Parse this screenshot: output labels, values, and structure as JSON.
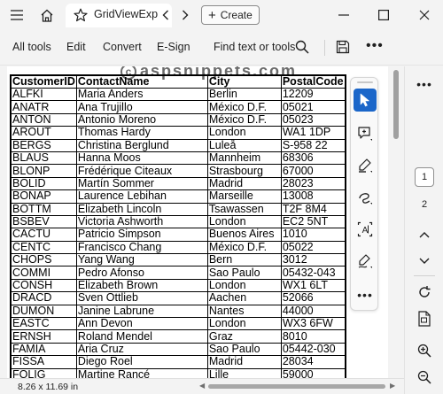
{
  "titlebar": {
    "tab_title": "GridViewExp",
    "create_label": "Create",
    "colors": {
      "bg": "#f3f3f3",
      "tab_bg": "#ffffff"
    }
  },
  "commandbar": {
    "all_tools": "All tools",
    "edit": "Edit",
    "convert": "Convert",
    "esign": "E-Sign",
    "find": "Find text or tools"
  },
  "watermark": {
    "symbol": "c",
    "text": "aspsnippets.com"
  },
  "table": {
    "headers": [
      "CustomerID",
      "ContactName",
      "City",
      "PostalCode"
    ],
    "rows": [
      [
        "ALFKI",
        "Maria Anders",
        "Berlin",
        "12209"
      ],
      [
        "ANATR",
        "Ana Trujillo",
        "México D.F.",
        "05021"
      ],
      [
        "ANTON",
        "Antonio Moreno",
        "México D.F.",
        "05023"
      ],
      [
        "AROUT",
        "Thomas Hardy",
        "London",
        "WA1 1DP"
      ],
      [
        "BERGS",
        "Christina Berglund",
        "Luleå",
        "S-958 22"
      ],
      [
        "BLAUS",
        "Hanna Moos",
        "Mannheim",
        "68306"
      ],
      [
        "BLONP",
        "Frédérique Citeaux",
        "Strasbourg",
        "67000"
      ],
      [
        "BOLID",
        "Martín Sommer",
        "Madrid",
        "28023"
      ],
      [
        "BONAP",
        "Laurence Lebihan",
        "Marseille",
        "13008"
      ],
      [
        "BOTTM",
        "Elizabeth Lincoln",
        "Tsawassen",
        "T2F 8M4"
      ],
      [
        "BSBEV",
        "Victoria Ashworth",
        "London",
        "EC2 5NT"
      ],
      [
        "CACTU",
        "Patricio Simpson",
        "Buenos Aires",
        "1010"
      ],
      [
        "CENTC",
        "Francisco Chang",
        "México D.F.",
        "05022"
      ],
      [
        "CHOPS",
        "Yang Wang",
        "Bern",
        "3012"
      ],
      [
        "COMMI",
        "Pedro Afonso",
        "Sao Paulo",
        "05432-043"
      ],
      [
        "CONSH",
        "Elizabeth Brown",
        "London",
        "WX1 6LT"
      ],
      [
        "DRACD",
        "Sven Ottlieb",
        "Aachen",
        "52066"
      ],
      [
        "DUMON",
        "Janine Labrune",
        "Nantes",
        "44000"
      ],
      [
        "EASTC",
        "Ann Devon",
        "London",
        "WX3 6FW"
      ],
      [
        "ERNSH",
        "Roland Mendel",
        "Graz",
        "8010"
      ],
      [
        "FAMIA",
        "Aria Cruz",
        "Sao Paulo",
        "05442-030"
      ],
      [
        "FISSA",
        "Diego Roel",
        "Madrid",
        "28034"
      ],
      [
        "FOLIG",
        "Martine Rancé",
        "Lille",
        "59000"
      ]
    ]
  },
  "tools": {
    "items": [
      "select-cursor-icon",
      "add-comment-icon",
      "highlight-pen-icon",
      "draw-freehand-icon",
      "text-select-icon",
      "fill-sign-icon",
      "more-icon"
    ]
  },
  "rail": {
    "current_page": "1",
    "next_page": "2"
  },
  "status": {
    "page_size": "8.26 x 11.69 in"
  },
  "colors": {
    "accent": "#1b66c9"
  }
}
